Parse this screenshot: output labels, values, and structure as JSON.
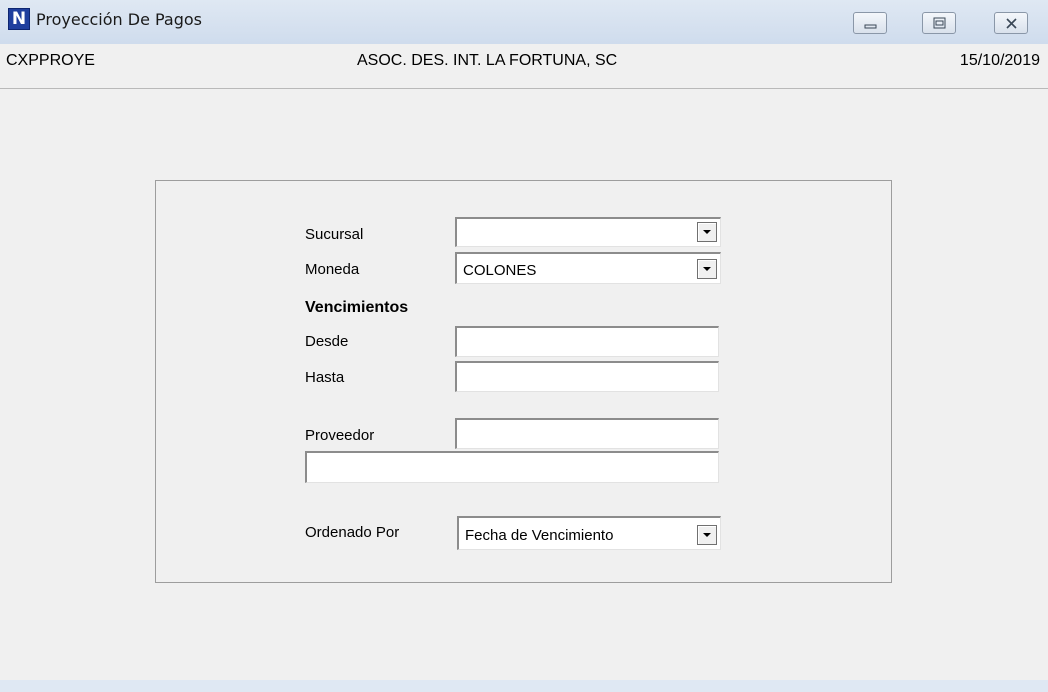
{
  "window": {
    "title": "Proyección De Pagos",
    "app_icon_letter": "N"
  },
  "header": {
    "program_code": "CXPPROYE",
    "company": "ASOC. DES. INT. LA FORTUNA, SC",
    "date": "15/10/2019"
  },
  "form": {
    "sucursal_label": "Sucursal",
    "sucursal_value": "",
    "moneda_label": "Moneda",
    "moneda_value": "COLONES",
    "vencimientos_heading": "Vencimientos",
    "desde_label": "Desde",
    "desde_value": "",
    "hasta_label": "Hasta",
    "hasta_value": "",
    "proveedor_label": "Proveedor",
    "proveedor_code_value": "",
    "proveedor_name_value": "",
    "ordenado_label": "Ordenado Por",
    "ordenado_value": "Fecha de Vencimiento"
  },
  "colors": {
    "app_icon": "#1f3f9e",
    "titlebar": "#dfe8f3",
    "background": "#f0f0f0"
  }
}
